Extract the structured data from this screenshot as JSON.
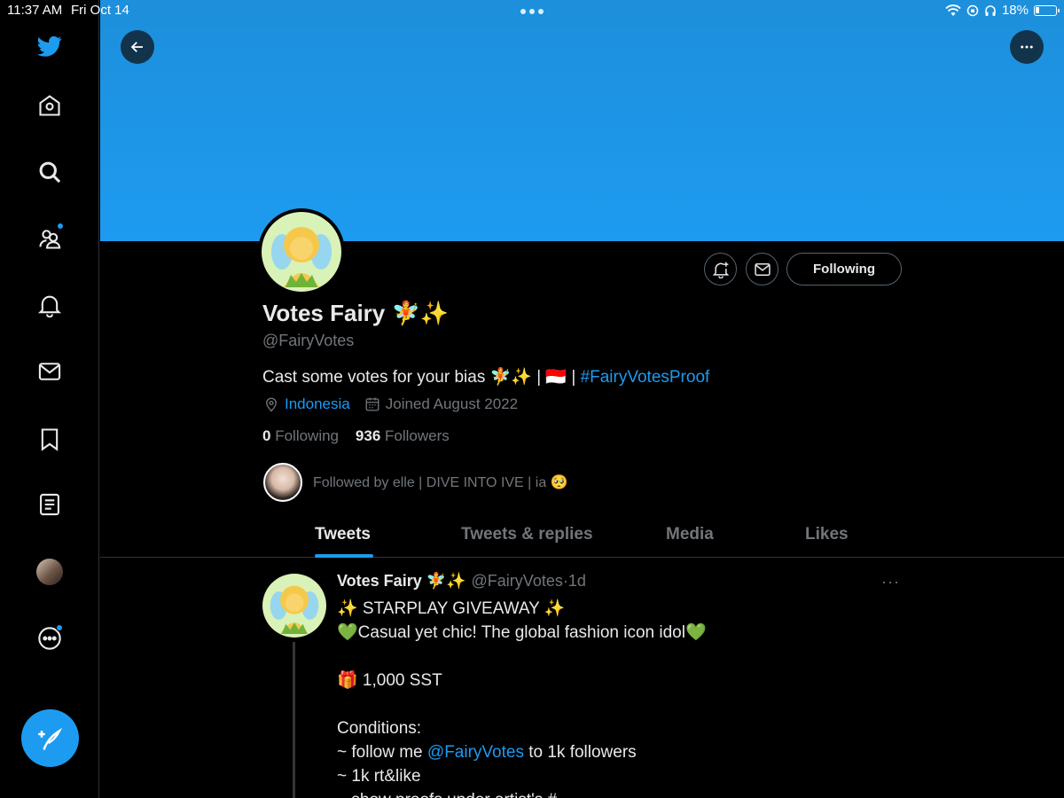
{
  "status_bar": {
    "time": "11:37 AM",
    "date": "Fri Oct 14",
    "battery": "18%"
  },
  "sidebar": {
    "items": [
      {
        "icon": "twitter-logo-icon"
      },
      {
        "icon": "home-icon"
      },
      {
        "icon": "search-icon"
      },
      {
        "icon": "communities-icon"
      },
      {
        "icon": "bell-icon"
      },
      {
        "icon": "mail-icon"
      },
      {
        "icon": "bookmark-icon"
      },
      {
        "icon": "lists-icon"
      },
      {
        "icon": "profile-avatar"
      },
      {
        "icon": "more-icon"
      }
    ],
    "accent": "#1d9bf0"
  },
  "profile": {
    "name": "Votes Fairy 🧚✨",
    "handle": "@FairyVotes",
    "bio_prefix": "Cast some votes for your bias 🧚✨ | 🇮🇩 | ",
    "bio_hashtag": "#FairyVotesProof",
    "location": "Indonesia",
    "joined": "Joined August 2022",
    "following_count": "0",
    "following_label": "Following",
    "followers_count": "936",
    "followers_label": "Followers",
    "followed_by": "Followed by elle | DIVE INTO IVE | ia 🥺",
    "following_button": "Following"
  },
  "tabs": [
    "Tweets",
    "Tweets & replies",
    "Media",
    "Likes"
  ],
  "tweet": {
    "name": "Votes Fairy 🧚✨",
    "handle": "@FairyVotes",
    "sep": "·",
    "age": "1d",
    "more": "···",
    "lines": [
      "✨ STARPLAY GIVEAWAY ✨",
      "💚Casual yet chic! The global fashion icon idol💚",
      "",
      "🎁 1,000 SST",
      "",
      "Conditions:"
    ],
    "cond1_prefix": "~ follow me ",
    "cond1_mention": "@FairyVotes",
    "cond1_suffix": " to 1k followers",
    "cond2": "~ 1k rt&like",
    "cond3": "~ show proofs under artist's #"
  },
  "colors": {
    "banner": "#1d9bf0",
    "link": "#1d9bf0",
    "muted": "#71767b",
    "text": "#e7e9ea"
  }
}
